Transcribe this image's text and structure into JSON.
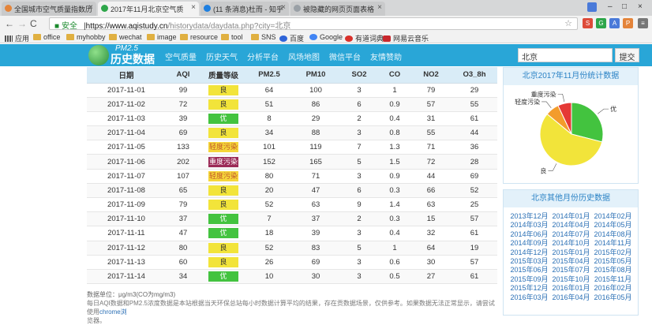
{
  "browser": {
    "tabs": [
      {
        "title": "全国城市空气质量指数历",
        "active": false,
        "favicon_color": "#e4843a"
      },
      {
        "title": "2017年11月北京空气质",
        "active": true,
        "favicon_color": "#2ea64a"
      },
      {
        "title": "(11 条消息)杜而 - 知乎",
        "active": false,
        "favicon_color": "#1e7fe0"
      },
      {
        "title": "被隐藏的网页页面表格",
        "active": false,
        "favicon_color": "#9aa0a6"
      }
    ],
    "window_buttons": [
      "–",
      "□",
      "×"
    ],
    "back": "←",
    "forward": "→",
    "reload": "C",
    "home": "⌂",
    "lock_icon": "🔒",
    "secure_label": "安全",
    "url_host": "https://www.aqistudy.cn",
    "url_path": "/historydata/daydata.php?city=北京",
    "star": "☆",
    "extensions": [
      {
        "label": "S",
        "color": "#dd4b39"
      },
      {
        "label": "G",
        "color": "#2ea64a"
      },
      {
        "label": "A",
        "color": "#4a7ad9"
      },
      {
        "label": "P",
        "color": "#e4843a"
      },
      {
        "label": "≡",
        "color": "#777777"
      }
    ]
  },
  "bookmarks": [
    {
      "label": "应用",
      "icon": "apps-icon"
    },
    {
      "label": "office",
      "icon": "folder-icon"
    },
    {
      "label": "myhobby",
      "icon": "folder-icon"
    },
    {
      "label": "wechat",
      "icon": "folder-icon"
    },
    {
      "label": "image",
      "icon": "folder-icon"
    },
    {
      "label": "resource",
      "icon": "folder-icon"
    },
    {
      "label": "tool",
      "icon": "folder-icon"
    },
    {
      "label": "SNS",
      "icon": "folder-icon"
    },
    {
      "label": "百度",
      "icon": "baidu-icon"
    },
    {
      "label": "Google",
      "icon": "google-icon"
    },
    {
      "label": "有道词典",
      "icon": "youdao-icon"
    },
    {
      "label": "网易云音乐",
      "icon": "netease-icon"
    }
  ],
  "site": {
    "logo_pm": "PM2.5",
    "logo_name": "历史数据",
    "nav": [
      "空气质量",
      "历史天气",
      "分析平台",
      "风场地图",
      "微信平台",
      "友情赞助"
    ],
    "search_value": "北京",
    "search_button": "提交"
  },
  "table": {
    "headers": [
      "日期",
      "AQI",
      "质量等级",
      "PM2.5",
      "PM10",
      "SO2",
      "CO",
      "NO2",
      "O3_8h"
    ],
    "rows": [
      [
        "2017-11-01",
        "99",
        "良",
        "64",
        "100",
        "3",
        "1",
        "79",
        "29"
      ],
      [
        "2017-11-02",
        "72",
        "良",
        "51",
        "86",
        "6",
        "0.9",
        "57",
        "55"
      ],
      [
        "2017-11-03",
        "39",
        "优",
        "8",
        "29",
        "2",
        "0.4",
        "31",
        "61"
      ],
      [
        "2017-11-04",
        "69",
        "良",
        "34",
        "88",
        "3",
        "0.8",
        "55",
        "44"
      ],
      [
        "2017-11-05",
        "133",
        "轻度污染",
        "101",
        "119",
        "7",
        "1.3",
        "71",
        "36"
      ],
      [
        "2017-11-06",
        "202",
        "重度污染",
        "152",
        "165",
        "5",
        "1.5",
        "72",
        "28"
      ],
      [
        "2017-11-07",
        "107",
        "轻度污染",
        "80",
        "71",
        "3",
        "0.9",
        "44",
        "69"
      ],
      [
        "2017-11-08",
        "65",
        "良",
        "20",
        "47",
        "6",
        "0.3",
        "66",
        "52"
      ],
      [
        "2017-11-09",
        "79",
        "良",
        "52",
        "63",
        "9",
        "1.4",
        "63",
        "25"
      ],
      [
        "2017-11-10",
        "37",
        "优",
        "7",
        "37",
        "2",
        "0.3",
        "15",
        "57"
      ],
      [
        "2017-11-11",
        "47",
        "优",
        "18",
        "39",
        "3",
        "0.4",
        "32",
        "61"
      ],
      [
        "2017-11-12",
        "80",
        "良",
        "52",
        "83",
        "5",
        "1",
        "64",
        "19"
      ],
      [
        "2017-11-13",
        "60",
        "良",
        "26",
        "69",
        "3",
        "0.6",
        "30",
        "57"
      ],
      [
        "2017-11-14",
        "34",
        "优",
        "10",
        "30",
        "3",
        "0.5",
        "27",
        "61"
      ]
    ],
    "level_colors": {
      "优": {
        "bg": "#43c33f",
        "fg": "#ffffff"
      },
      "良": {
        "bg": "#f2e43a",
        "fg": "#333333"
      },
      "轻度污染": {
        "bg": "#f5d63a",
        "fg": "#c2572b"
      },
      "重度污染": {
        "bg": "#9b2a57",
        "fg": "#ffffff"
      }
    }
  },
  "notes": {
    "units": "数据单位：μg/m3(CO为mg/m3)",
    "text": "每日AQI数据和PM2.5浓度数据是本站根据当天环保总站每小时数据计算平均的结果，存在贡数据场景，仅供参考。如果数据无法正常显示，请尝试使用",
    "link": "chrome浏",
    "text_end": "览器。"
  },
  "pie_panel": {
    "title": "北京2017年11月份统计数据",
    "chart_data": {
      "type": "pie",
      "slices": [
        {
          "label": "优",
          "value": 29,
          "color": "#43c33f"
        },
        {
          "label": "良",
          "value": 57,
          "color": "#f2e43a"
        },
        {
          "label": "轻度污染",
          "value": 7,
          "color": "#f39c2c"
        },
        {
          "label": "重度污染",
          "value": 7,
          "color": "#e53935"
        }
      ]
    }
  },
  "history_panel": {
    "title": "北京其他月份历史数据",
    "months": [
      "2013年12月",
      "2014年01月",
      "2014年02月",
      "2014年03月",
      "2014年04月",
      "2014年05月",
      "2014年06月",
      "2014年07月",
      "2014年08月",
      "2014年09月",
      "2014年10月",
      "2014年11月",
      "2014年12月",
      "2015年01月",
      "2015年02月",
      "2015年03月",
      "2015年04月",
      "2015年05月",
      "2015年06月",
      "2015年07月",
      "2015年08月",
      "2015年09月",
      "2015年10月",
      "2015年11月",
      "2015年12月",
      "2016年01月",
      "2016年02月",
      "2016年03月",
      "2016年04月",
      "2016年05月"
    ]
  }
}
